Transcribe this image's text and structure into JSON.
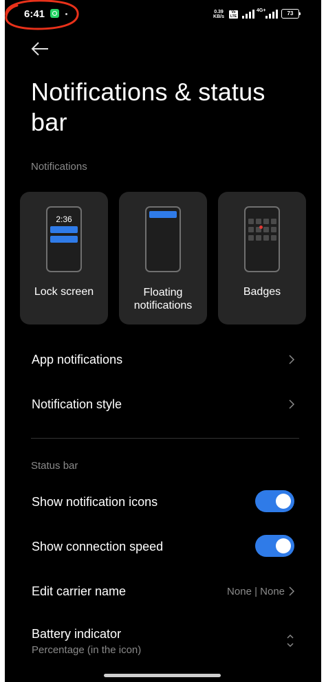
{
  "status_bar": {
    "time": "6:41",
    "speed_value": "0.39",
    "speed_unit": "KB/s",
    "network": "4G+",
    "battery": "73",
    "notification_icon": "whatsapp-icon"
  },
  "header": {
    "title": "Notifications & status bar"
  },
  "notifications_section": {
    "label": "Notifications",
    "tiles": [
      {
        "label": "Lock screen",
        "preview_time": "2:36"
      },
      {
        "label": "Floating notifications"
      },
      {
        "label": "Badges"
      }
    ]
  },
  "items": {
    "app_notifications": "App notifications",
    "notification_style": "Notification style"
  },
  "status_section": {
    "label": "Status bar",
    "show_notification_icons": {
      "label": "Show notification icons",
      "enabled": true
    },
    "show_connection_speed": {
      "label": "Show connection speed",
      "enabled": true
    },
    "edit_carrier_name": {
      "label": "Edit carrier name",
      "value": "None | None"
    },
    "battery_indicator": {
      "label": "Battery indicator",
      "value": "Percentage (in the icon)"
    }
  },
  "colors": {
    "accent": "#2f7be8",
    "background": "#000000",
    "tile": "#262626",
    "annotation": "#e8311a"
  }
}
